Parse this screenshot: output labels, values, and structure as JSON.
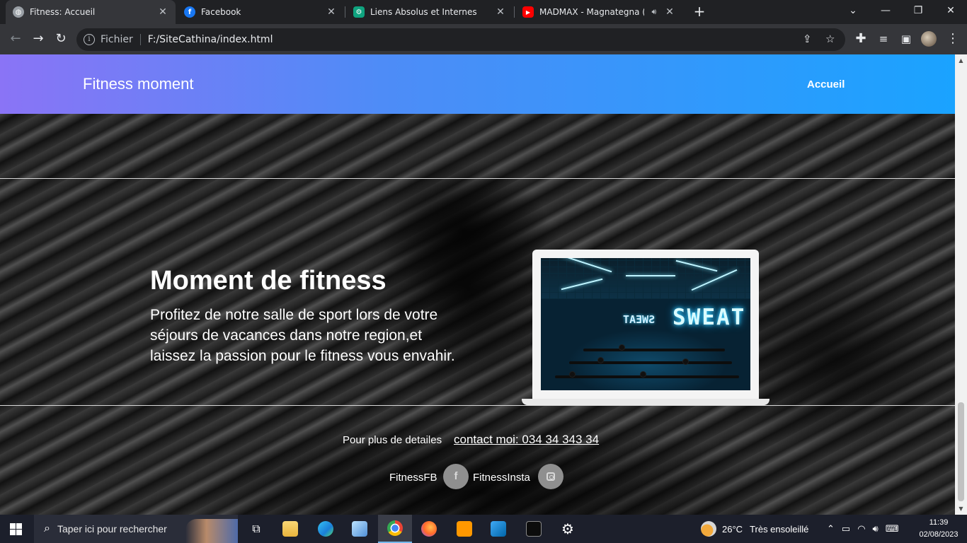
{
  "browser": {
    "tabs": [
      {
        "title": "Fitness: Accueil",
        "icon": "globe-icon",
        "active": true
      },
      {
        "title": "Facebook",
        "icon": "facebook-icon",
        "active": false
      },
      {
        "title": "Liens Absolus et Internes",
        "icon": "chatgpt-icon",
        "active": false
      },
      {
        "title": "MADMAX - Magnategna (Cli",
        "icon": "youtube-icon",
        "active": false
      }
    ],
    "address": {
      "scheme_label": "Fichier",
      "url": "F:/SiteCathina/index.html"
    }
  },
  "page": {
    "brand": "Fitness moment",
    "nav_link": "Accueil",
    "hero_title": "Moment de fitness",
    "hero_text": "Profitez de notre salle de sport lors de votre séjours de vacances dans notre region,et laissez la passion pour le fitness vous envahir.",
    "laptop_screen_text": "SWEAT",
    "contact_lead": "Pour plus de detailes",
    "contact_link": "contact moi: 034 34 343 34",
    "social": {
      "fb_label": "FitnessFB",
      "insta_label": "FitnessInsta",
      "fb_glyph": "f"
    },
    "colors": {
      "nav_gradient_start": "#8a74f6",
      "nav_gradient_end": "#1aa3ff"
    }
  },
  "taskbar": {
    "search_placeholder": "Taper ici pour rechercher",
    "weather": {
      "temp": "26°C",
      "condition": "Très ensoleillé"
    },
    "clock": {
      "time": "11:39",
      "date": "02/08/2023"
    }
  }
}
